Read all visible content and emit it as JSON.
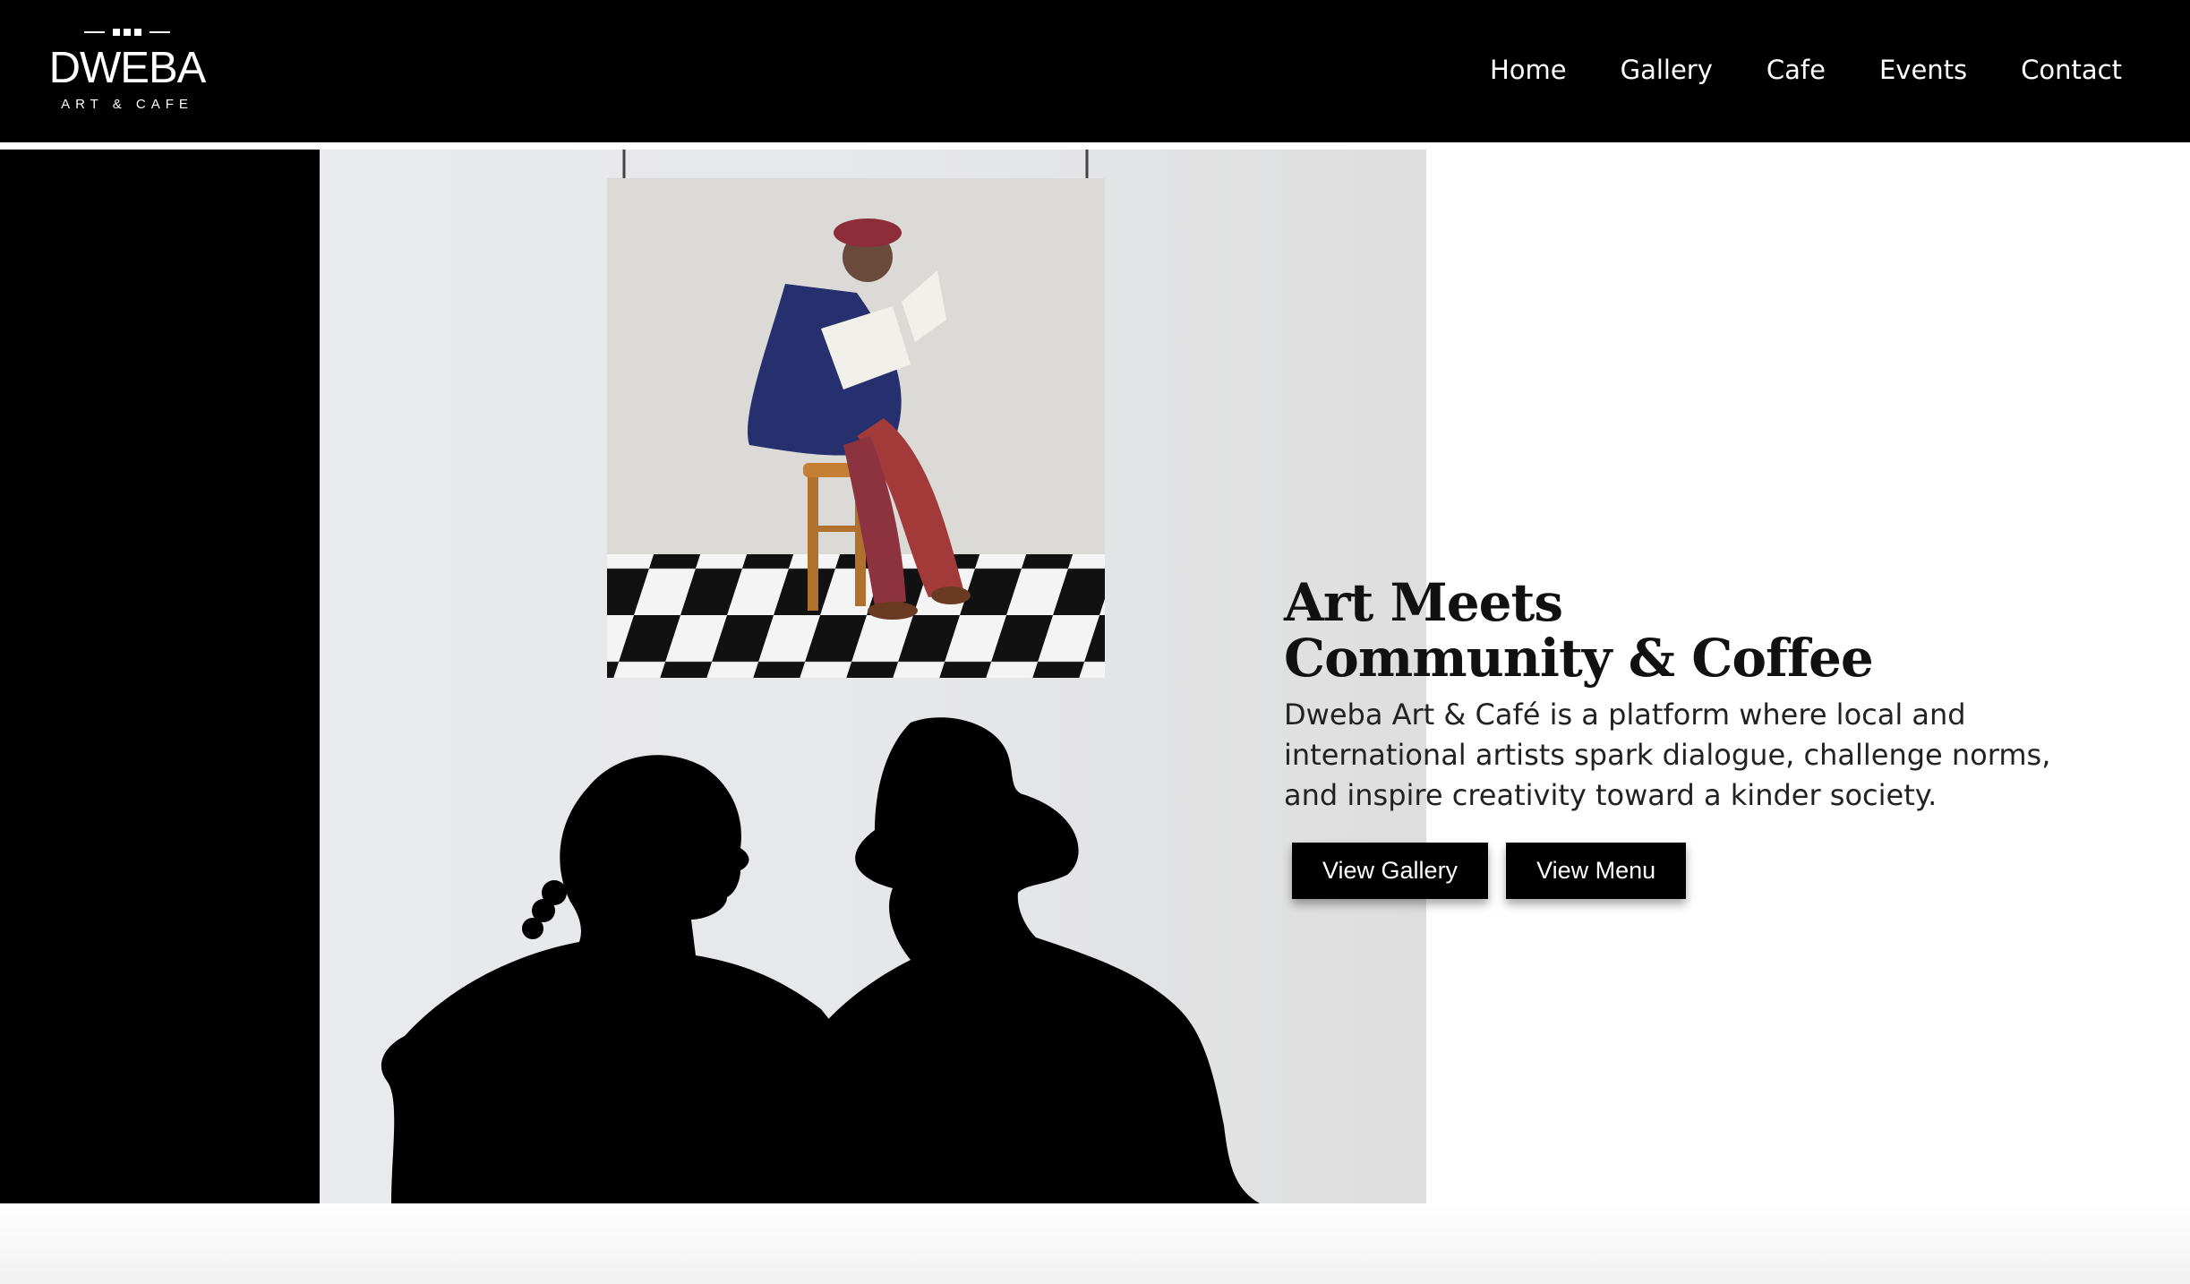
{
  "header": {
    "logo": {
      "wordmark": "DWEBA",
      "subtitle": "ART & CAFE"
    },
    "nav": [
      {
        "label": "Home"
      },
      {
        "label": "Gallery"
      },
      {
        "label": "Cafe"
      },
      {
        "label": "Events"
      },
      {
        "label": "Contact"
      }
    ]
  },
  "hero": {
    "title_line1": "Art Meets",
    "title_line2": "Community & Coffee",
    "description": "Dweba Art & Café is a platform where local and international artists spark dialogue, challenge norms, and inspire creativity toward a kinder society.",
    "buttons": {
      "gallery": "View Gallery",
      "menu": "View Menu"
    },
    "image_alt_icon": "gallery-visitors-silhouette-image"
  },
  "colors": {
    "header_bg": "#000000",
    "button_bg": "#000000",
    "text": "#111111"
  }
}
